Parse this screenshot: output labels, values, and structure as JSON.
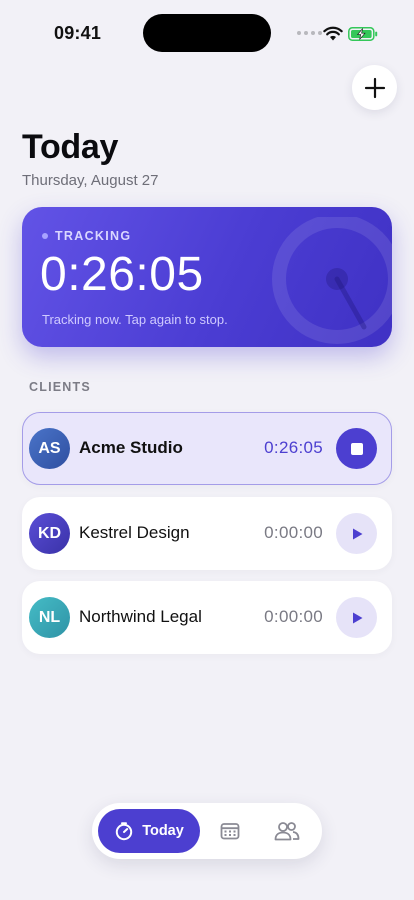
{
  "status_bar": {
    "time": "09:41"
  },
  "header": {
    "title": "Today",
    "date": "Thursday, August 27",
    "add_icon": "plus-icon"
  },
  "tracking": {
    "label": "TRACKING",
    "timer": "0:26:05",
    "hint": "Tracking now. Tap again to stop."
  },
  "clients_section": {
    "label": "CLIENTS"
  },
  "clients": [
    {
      "initials": "AS",
      "name": "Acme Studio",
      "time": "0:26:05",
      "active": true,
      "action_icon": "stop-icon",
      "avatar_color": "#3f62b8"
    },
    {
      "initials": "KD",
      "name": "Kestrel Design",
      "time": "0:00:00",
      "active": false,
      "action_icon": "play-icon",
      "avatar_color": "#4a3fc4"
    },
    {
      "initials": "NL",
      "name": "Northwind Legal",
      "time": "0:00:00",
      "active": false,
      "action_icon": "play-icon",
      "avatar_color": "#3aa7b8"
    }
  ],
  "tab_bar": {
    "today_label": "Today",
    "tabs": [
      {
        "name": "today",
        "icon": "timer-icon",
        "selected": true
      },
      {
        "name": "calendar",
        "icon": "calendar-icon",
        "selected": false
      },
      {
        "name": "clients",
        "icon": "people-icon",
        "selected": false
      }
    ]
  },
  "colors": {
    "accent": "#4c3fd0",
    "background": "#f2f1f7",
    "active_row": "#e9e6fb"
  }
}
